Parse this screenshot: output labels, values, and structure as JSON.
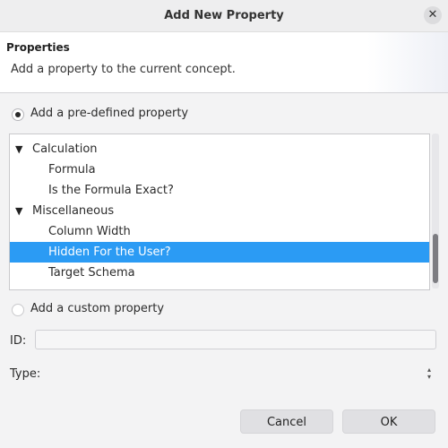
{
  "window": {
    "title": "Add New Property",
    "close_icon": "close-icon"
  },
  "header": {
    "title": "Properties",
    "description": "Add a property to the current concept."
  },
  "predefined": {
    "label": "Add a pre-defined property",
    "selected": true,
    "tree": [
      {
        "label": "Calculation",
        "type": "group",
        "expanded": true
      },
      {
        "label": "Formula",
        "type": "item"
      },
      {
        "label": "Is the Formula Exact?",
        "type": "item"
      },
      {
        "label": "Miscellaneous",
        "type": "group",
        "expanded": true
      },
      {
        "label": "Column Width",
        "type": "item"
      },
      {
        "label": "Hidden For the User?",
        "type": "item",
        "selected": true
      },
      {
        "label": "Target Schema",
        "type": "item"
      }
    ]
  },
  "custom": {
    "label": "Add a custom property",
    "selected": false
  },
  "fields": {
    "id_label": "ID:",
    "id_value": "",
    "type_label": "Type:",
    "type_value": ""
  },
  "buttons": {
    "cancel": "Cancel",
    "ok": "OK"
  },
  "colors": {
    "selection": "#2b9bf4",
    "background": "#f3f3f4"
  }
}
